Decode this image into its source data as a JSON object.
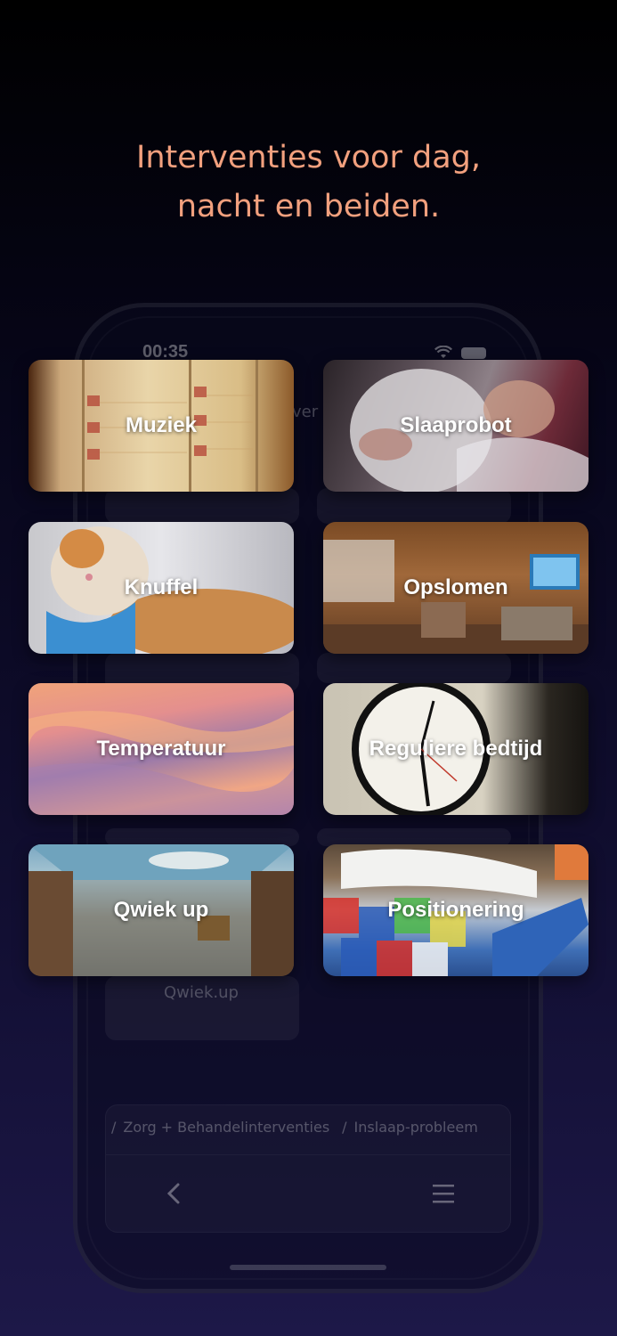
{
  "headline": {
    "line1": "Interventies voor dag,",
    "line2": "nacht en beiden."
  },
  "phone": {
    "status_time": "00:35",
    "ghost_title_fragment": "ver",
    "ghost_card_label": "Qwiek.up",
    "breadcrumb": [
      {
        "separator": "/",
        "label": "Zorg + Behandelinterventies"
      },
      {
        "separator": "/",
        "label": "Inslaap-probleem"
      }
    ],
    "nav": {
      "back_icon": "chevron-left-icon",
      "menu_icon": "hamburger-menu-icon"
    }
  },
  "tiles": [
    {
      "label": "Muziek",
      "image": "jukebox-photo"
    },
    {
      "label": "Slaaprobot",
      "image": "sleeping-woman-with-robot-photo"
    },
    {
      "label": "Knuffel",
      "image": "robotic-cat-photo"
    },
    {
      "label": "Opslomen",
      "image": "care-home-lounge-photo"
    },
    {
      "label": "Temperatuur",
      "image": "sunset-clouds-photo"
    },
    {
      "label": "Reguliere bedtijd",
      "image": "wall-clock-photo"
    },
    {
      "label": "Qwiek up",
      "image": "ceiling-projection-room-photo"
    },
    {
      "label": "Positionering",
      "image": "quilt-and-pillow-photo"
    }
  ]
}
